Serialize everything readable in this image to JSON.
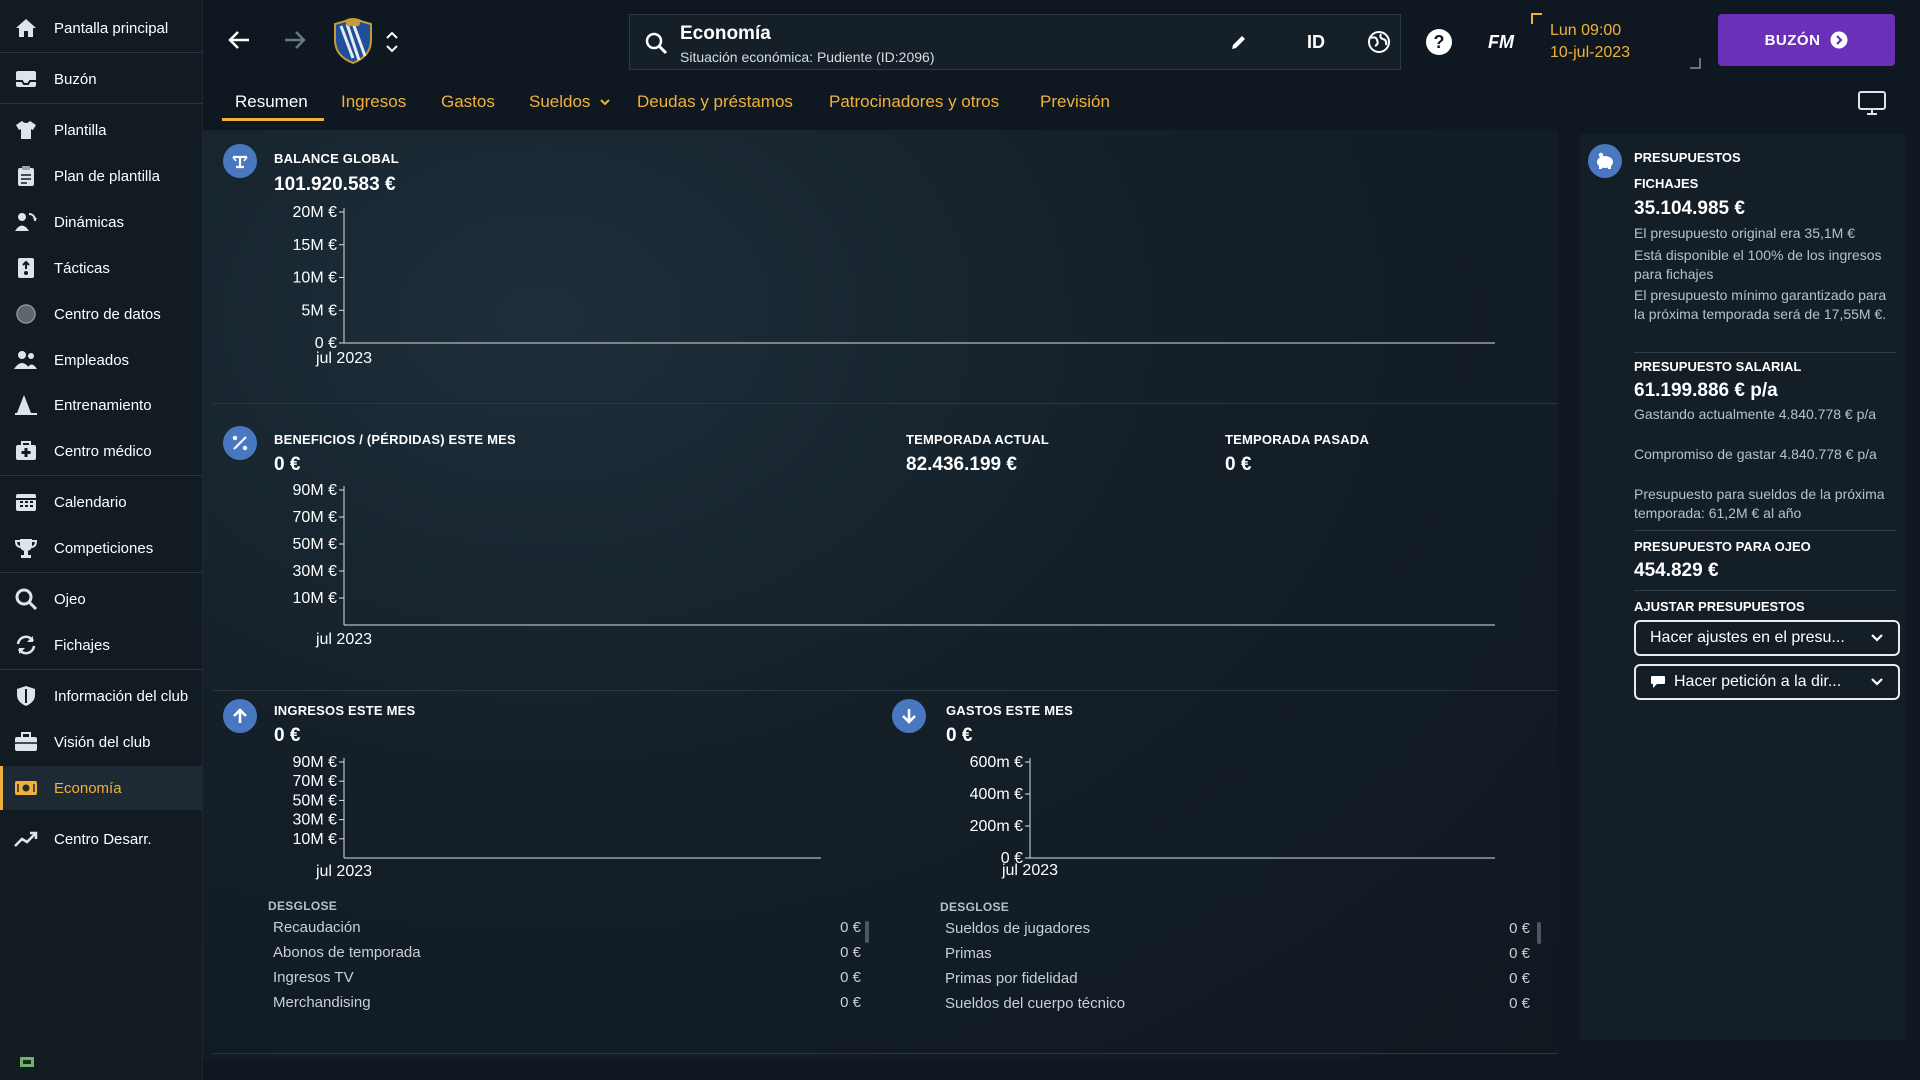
{
  "sidebar": {
    "items": [
      {
        "label": "Pantalla principal",
        "icon": "home-icon"
      },
      {
        "label": "Buzón",
        "icon": "inbox-icon"
      },
      {
        "label": "Plantilla",
        "icon": "shirt-icon"
      },
      {
        "label": "Plan de plantilla",
        "icon": "clipboard-icon"
      },
      {
        "label": "Dinámicas",
        "icon": "people-cycle-icon"
      },
      {
        "label": "Tácticas",
        "icon": "tactics-board-icon"
      },
      {
        "label": "Centro de datos",
        "icon": "data-ball-icon"
      },
      {
        "label": "Empleados",
        "icon": "staff-icon"
      },
      {
        "label": "Entrenamiento",
        "icon": "training-cone-icon"
      },
      {
        "label": "Centro médico",
        "icon": "medical-kit-icon"
      },
      {
        "label": "Calendario",
        "icon": "calendar-icon"
      },
      {
        "label": "Competiciones",
        "icon": "trophy-icon"
      },
      {
        "label": "Ojeo",
        "icon": "scout-magnifier-icon"
      },
      {
        "label": "Fichajes",
        "icon": "transfer-arrows-icon"
      },
      {
        "label": "Información del club",
        "icon": "club-shield-icon"
      },
      {
        "label": "Visión del club",
        "icon": "briefcase-icon"
      },
      {
        "label": "Economía",
        "icon": "money-icon",
        "active": true
      },
      {
        "label": "Centro Desarr.",
        "icon": "growth-chart-icon"
      }
    ]
  },
  "search": {
    "title": "Economía",
    "subtitle": "Situación económica: Pudiente (ID:2096)"
  },
  "topbar": {
    "id_label": "ID",
    "fm_label": "FM",
    "time": "Lun 09:00",
    "date": "10-jul-2023",
    "inbox_label": "BUZÓN"
  },
  "tabs": [
    {
      "label": "Resumen",
      "active": true
    },
    {
      "label": "Ingresos"
    },
    {
      "label": "Gastos"
    },
    {
      "label": "Sueldos"
    },
    {
      "label": "Deudas y préstamos"
    },
    {
      "label": "Patrocinadores y otros"
    },
    {
      "label": "Previsión"
    }
  ],
  "balance": {
    "title": "BALANCE GLOBAL",
    "value": "101.920.583 €"
  },
  "profit": {
    "title": "BENEFICIOS / (PÉRDIDAS) ESTE MES",
    "value": "0 €",
    "current_season_title": "TEMPORADA ACTUAL",
    "current_season_value": "82.436.199 €",
    "last_season_title": "TEMPORADA PASADA",
    "last_season_value": "0 €"
  },
  "income": {
    "title": "INGRESOS ESTE MES",
    "value": "0 €",
    "breakdown_title": "DESGLOSE",
    "rows": [
      {
        "label": "Recaudación",
        "value": "0 €"
      },
      {
        "label": "Abonos de temporada",
        "value": "0 €"
      },
      {
        "label": "Ingresos TV",
        "value": "0 €"
      },
      {
        "label": "Merchandising",
        "value": "0 €"
      }
    ]
  },
  "expenses": {
    "title": "GASTOS ESTE MES",
    "value": "0 €",
    "breakdown_title": "DESGLOSE",
    "rows": [
      {
        "label": "Sueldos de jugadores",
        "value": "0 €"
      },
      {
        "label": "Primas",
        "value": "0 €"
      },
      {
        "label": "Primas por fidelidad",
        "value": "0 €"
      },
      {
        "label": "Sueldos del cuerpo técnico",
        "value": "0 €"
      }
    ]
  },
  "chart_data": [
    {
      "type": "line",
      "name": "balance",
      "x": [
        "jul 2023"
      ],
      "y_ticks": [
        "20M €",
        "15M €",
        "10M €",
        "5M €",
        "0 €"
      ],
      "series": []
    },
    {
      "type": "line",
      "name": "profit",
      "x": [
        "jul 2023"
      ],
      "y_ticks": [
        "90M €",
        "70M €",
        "50M €",
        "30M €",
        "10M €"
      ],
      "series": []
    },
    {
      "type": "line",
      "name": "income",
      "x": [
        "jul 2023"
      ],
      "y_ticks": [
        "90M €",
        "70M €",
        "50M €",
        "30M €",
        "10M €"
      ],
      "series": []
    },
    {
      "type": "line",
      "name": "expenses",
      "x": [
        "jul 2023"
      ],
      "y_ticks": [
        "600m €",
        "400m €",
        "200m €",
        "0 €"
      ],
      "series": []
    }
  ],
  "budgets": {
    "title": "PRESUPUESTOS",
    "transfers_title": "FICHAJES",
    "transfers_value": "35.104.985 €",
    "transfers_notes": [
      "El presupuesto original era 35,1M €",
      "Está disponible el 100% de los ingresos para fichajes",
      "El presupuesto mínimo garantizado para la próxima temporada será de 17,55M €."
    ],
    "wage_title": "PRESUPUESTO SALARIAL",
    "wage_value": "61.199.886 € p/a",
    "wage_notes": [
      "Gastando actualmente 4.840.778 € p/a",
      "Compromiso de gastar 4.840.778 € p/a",
      "Presupuesto para sueldos de la próxima temporada: 61,2M € al año"
    ],
    "scouting_title": "PRESUPUESTO PARA OJEO",
    "scouting_value": "454.829 €",
    "adjust_title": "AJUSTAR PRESUPUESTOS",
    "adjust_dropdown": "Hacer ajustes en el presu...",
    "request_dropdown": "Hacer petición a la dir..."
  },
  "colors": {
    "accent": "#f0b13c",
    "inbox_button": "#6a31b8",
    "icon_circle": "#4a78c0"
  }
}
